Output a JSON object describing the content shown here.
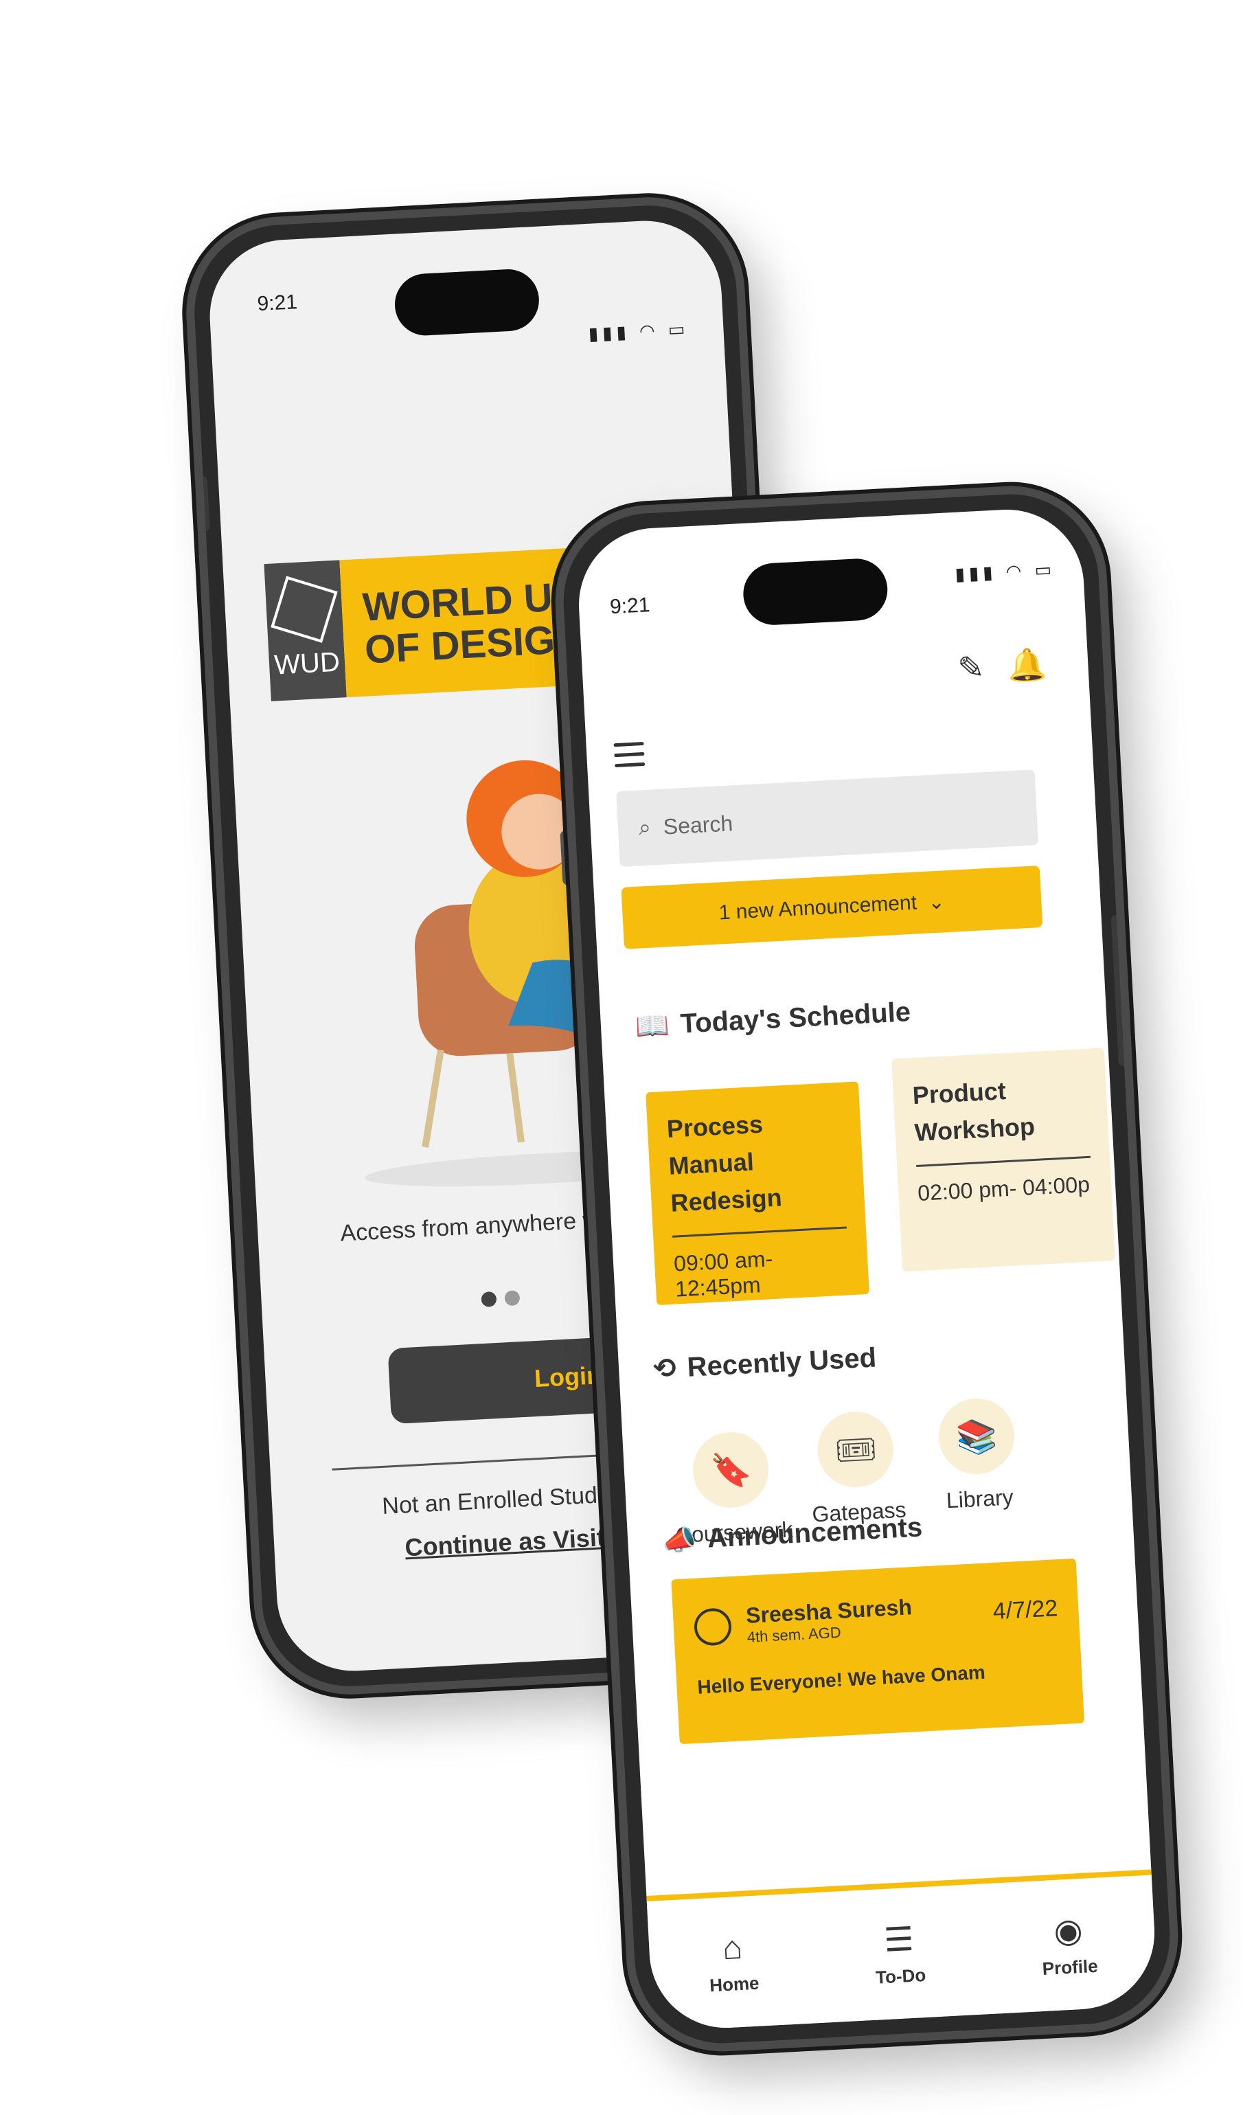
{
  "back_phone": {
    "status_time": "9:21",
    "status_icons": "▮▮▮ ◠ ▭",
    "logo_mark": "WUD",
    "logo_line1": "WORLD UNIV",
    "logo_line2": "OF DESIGN",
    "tagline": "Access from anywhere w",
    "login_label": "Login",
    "not_enrolled": "Not an Enrolled Studen",
    "continue_visitor": "Continue as Visito"
  },
  "front_phone": {
    "status_time": "9:21",
    "status_icons": "▮▮▮ ◠ ▭",
    "search_placeholder": "Search",
    "announcement_bar": "1 new Announcement",
    "schedule_title": "Today's Schedule",
    "schedule": [
      {
        "title": "Process Manual Redesign",
        "time": "09:00 am- 12:45pm"
      },
      {
        "title": "Product Workshop",
        "time": "02:00 pm- 04:00p"
      }
    ],
    "recent_title": "Recently Used",
    "recent_items": [
      {
        "label": "Coursework"
      },
      {
        "label": "Gatepass"
      },
      {
        "label": "Library"
      }
    ],
    "announcements_title": "Announcements",
    "announcement": {
      "name": "Sreesha Suresh",
      "sub": "4th sem. AGD",
      "date": "4/7/22",
      "preview": "Hello Everyone! We have Onam"
    },
    "nav": [
      {
        "label": "Home"
      },
      {
        "label": "To-Do"
      },
      {
        "label": "Profile"
      }
    ]
  },
  "colors": {
    "accent": "#f6bd0c",
    "cream": "#f8efd4",
    "frame": "#2a2a2a"
  }
}
